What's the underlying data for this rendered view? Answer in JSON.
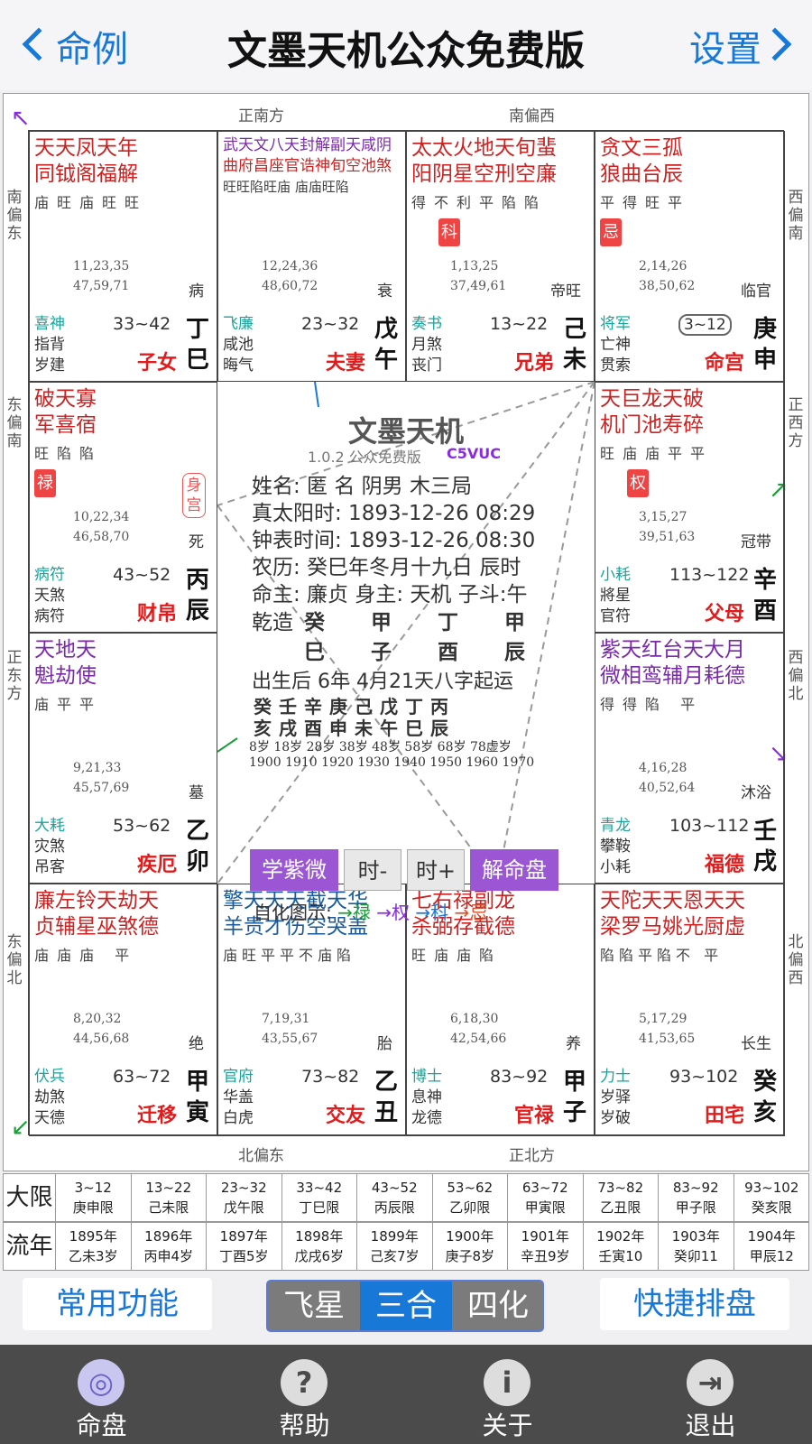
{
  "header": {
    "back_label": "命例",
    "title": "文墨天机公众免费版",
    "settings_label": "设置"
  },
  "directions": {
    "top_left": "正南方",
    "top_right": "南偏西",
    "bottom_left": "北偏东",
    "bottom_right": "正北方",
    "left_1": "南偏东",
    "left_2": "东偏南",
    "left_3": "正东方",
    "left_4": "东偏北",
    "right_1": "西偏南",
    "right_2": "正西方",
    "right_3": "西偏北",
    "right_4": "北偏西"
  },
  "palaces": {
    "si": {
      "s1": "天天凤天年",
      "s2": "同钺阁福解",
      "b": "庙旺庙旺旺",
      "ages1": "11,23,35",
      "ages2": "47,59,71",
      "stage": "病",
      "sp1": "喜神",
      "sp2": "指背",
      "sp3": "岁建",
      "range": "33~42",
      "name": "子女",
      "gan": "丁",
      "zhi": "巳"
    },
    "wu": {
      "s1": "武天文八天封解副天咸阴",
      "s2": "曲府昌座官诰神旬空池煞",
      "b": "旺旺陷旺庙 庙庙旺陷",
      "ages1": "12,24,36",
      "ages2": "48,60,72",
      "stage": "衰",
      "sp1": "飞廉",
      "sp2": "咸池",
      "sp3": "晦气",
      "range": "23~32",
      "name": "夫妻",
      "gan": "戊",
      "zhi": "午"
    },
    "wei": {
      "s1": "太太火地天旬蜚",
      "s2": "阳阴星空刑空廉",
      "b": "得不利平陷陷",
      "hua": "科",
      "ages1": "1,13,25",
      "ages2": "37,49,61",
      "stage": "帝旺",
      "sp1": "奏书",
      "sp2": "月煞",
      "sp3": "丧门",
      "range": "13~22",
      "name": "兄弟",
      "gan": "己",
      "zhi": "未"
    },
    "shen": {
      "s1": "贪文三孤",
      "s2": "狼曲台辰",
      "b": "平得旺平",
      "hua": "忌",
      "ages1": "2,14,26",
      "ages2": "38,50,62",
      "stage": "临官",
      "sp1": "将军",
      "sp2": "亡神",
      "sp3": "贯索",
      "range": "3~12",
      "name": "命宫",
      "gan": "庚",
      "zhi": "申"
    },
    "chen": {
      "s1": "破天寡",
      "s2": "军喜宿",
      "b": "旺陷陷",
      "hua": "禄",
      "body": "身宫",
      "ages1": "10,22,34",
      "ages2": "46,58,70",
      "stage": "死",
      "sp1": "病符",
      "sp2": "天煞",
      "sp3": "病符",
      "range": "43~52",
      "name": "财帛",
      "gan": "丙",
      "zhi": "辰"
    },
    "you": {
      "s1": "天巨龙天破",
      "s2": "机门池寿碎",
      "b": "旺庙庙平平",
      "hua": "权",
      "ages1": "3,15,27",
      "ages2": "39,51,63",
      "stage": "冠带",
      "sp1": "小耗",
      "sp2": "將星",
      "sp3": "官符",
      "range": "113~122",
      "name": "父母",
      "gan": "辛",
      "zhi": "酉"
    },
    "mao": {
      "s1": "天地天",
      "s2": "魁劫使",
      "b": "庙平平",
      "ages1": "9,21,33",
      "ages2": "45,57,69",
      "stage": "墓",
      "sp1": "大耗",
      "sp2": "灾煞",
      "sp3": "吊客",
      "range": "53~62",
      "name": "疾厄",
      "gan": "乙",
      "zhi": "卯"
    },
    "xu": {
      "s1": "紫天红台天大月",
      "s2": "微相鸾辅月耗德",
      "b": "得得陷 平",
      "ages1": "4,16,28",
      "ages2": "40,52,64",
      "stage": "沐浴",
      "sp1": "青龙",
      "sp2": "攀鞍",
      "sp3": "小耗",
      "range": "103~112",
      "name": "福德",
      "gan": "壬",
      "zhi": "戌"
    },
    "yin": {
      "s1": "廉左铃天劫天",
      "s2": "贞辅星巫煞德",
      "b": "庙庙庙 平",
      "ages1": "8,20,32",
      "ages2": "44,56,68",
      "stage": "绝",
      "sp1": "伏兵",
      "sp2": "劫煞",
      "sp3": "天德",
      "range": "63~72",
      "name": "迁移",
      "gan": "甲",
      "zhi": "寅"
    },
    "chou": {
      "s1": "擎天天天截天华",
      "s2": "羊贵才伤空哭盖",
      "b": "庙旺平平不庙陷",
      "ages1": "7,19,31",
      "ages2": "43,55,67",
      "stage": "胎",
      "sp1": "官府",
      "sp2": "华盖",
      "sp3": "白虎",
      "range": "73~82",
      "name": "交友",
      "gan": "乙",
      "zhi": "丑"
    },
    "zi": {
      "s1": "七右禄副龙",
      "s2": "杀弼存截德",
      "b": "旺庙庙陷",
      "ages1": "6,18,30",
      "ages2": "42,54,66",
      "stage": "养",
      "sp1": "博士",
      "sp2": "息神",
      "sp3": "龙德",
      "range": "83~92",
      "name": "官禄",
      "gan": "甲",
      "zhi": "子"
    },
    "hai": {
      "s1": "天陀天天恩天天",
      "s2": "梁罗马姚光厨虚",
      "b": "陷陷平陷不 平",
      "ages1": "5,17,29",
      "ages2": "41,53,65",
      "stage": "长生",
      "sp1": "力士",
      "sp2": "岁驿",
      "sp3": "岁破",
      "range": "93~102",
      "name": "田宅",
      "gan": "癸",
      "zhi": "亥"
    }
  },
  "center": {
    "title": "文墨天机",
    "version": "1.0.2 公众免费版",
    "code": "C5VUC",
    "line1": "姓名: 匿 名       阴男 木三局",
    "line2": "真太阳时: 1893-12-26   08:29",
    "line3": "钟表时间: 1893-12-26   08:30",
    "line4": "农历: 癸巳年冬月十九日 辰时",
    "line5": "命主: 廉贞 身主: 天机 子斗:午",
    "bazi_label": "乾造",
    "bazi_top": [
      "癸",
      "甲",
      "丁",
      "甲"
    ],
    "bazi_bottom": [
      "巳",
      "子",
      "酉",
      "辰"
    ],
    "yun_line": "出生后 6年 4月21天八字起运",
    "dayun_gan": "癸壬辛庚己戊丁丙",
    "dayun_zhi": "亥戌酉申未午巳辰",
    "dayun_ages": "8岁  18岁 28岁 38岁 48岁 58岁 68岁 78虚岁",
    "dayun_years": "1900 1910 1920 1930 1940 1950 1960 1970",
    "btn1": "学紫微",
    "btn2": "时-",
    "btn3": "时+",
    "btn4": "解命盘",
    "legend_label": "自化图示:",
    "legend_lu": "→禄",
    "legend_quan": "→权",
    "legend_ke": "→科",
    "legend_ji": "→忌"
  },
  "daxian": {
    "label": "大限",
    "items": [
      {
        "a": "3~12",
        "b": "庚申限"
      },
      {
        "a": "13~22",
        "b": "己未限"
      },
      {
        "a": "23~32",
        "b": "戊午限"
      },
      {
        "a": "33~42",
        "b": "丁巳限"
      },
      {
        "a": "43~52",
        "b": "丙辰限"
      },
      {
        "a": "53~62",
        "b": "乙卯限"
      },
      {
        "a": "63~72",
        "b": "甲寅限"
      },
      {
        "a": "73~82",
        "b": "乙丑限"
      },
      {
        "a": "83~92",
        "b": "甲子限"
      },
      {
        "a": "93~102",
        "b": "癸亥限"
      }
    ]
  },
  "liunian": {
    "label": "流年",
    "items": [
      {
        "a": "1895年",
        "b": "乙未3岁"
      },
      {
        "a": "1896年",
        "b": "丙申4岁"
      },
      {
        "a": "1897年",
        "b": "丁酉5岁"
      },
      {
        "a": "1898年",
        "b": "戊戌6岁"
      },
      {
        "a": "1899年",
        "b": "己亥7岁"
      },
      {
        "a": "1900年",
        "b": "庚子8岁"
      },
      {
        "a": "1901年",
        "b": "辛丑9岁"
      },
      {
        "a": "1902年",
        "b": "壬寅10"
      },
      {
        "a": "1903年",
        "b": "癸卯11"
      },
      {
        "a": "1904年",
        "b": "甲辰12"
      }
    ]
  },
  "toolbar": {
    "common": "常用功能",
    "seg1": "飞星",
    "seg2": "三合",
    "seg3": "四化",
    "quick": "快捷排盘"
  },
  "nav": {
    "chart": "命盘",
    "help": "帮助",
    "about": "关于",
    "exit": "退出"
  },
  "colors": {
    "accent": "#1778d8",
    "palace_name": "#e21c1c",
    "purple": "#9b57d3",
    "nav_bg": "#4b4b4b"
  }
}
